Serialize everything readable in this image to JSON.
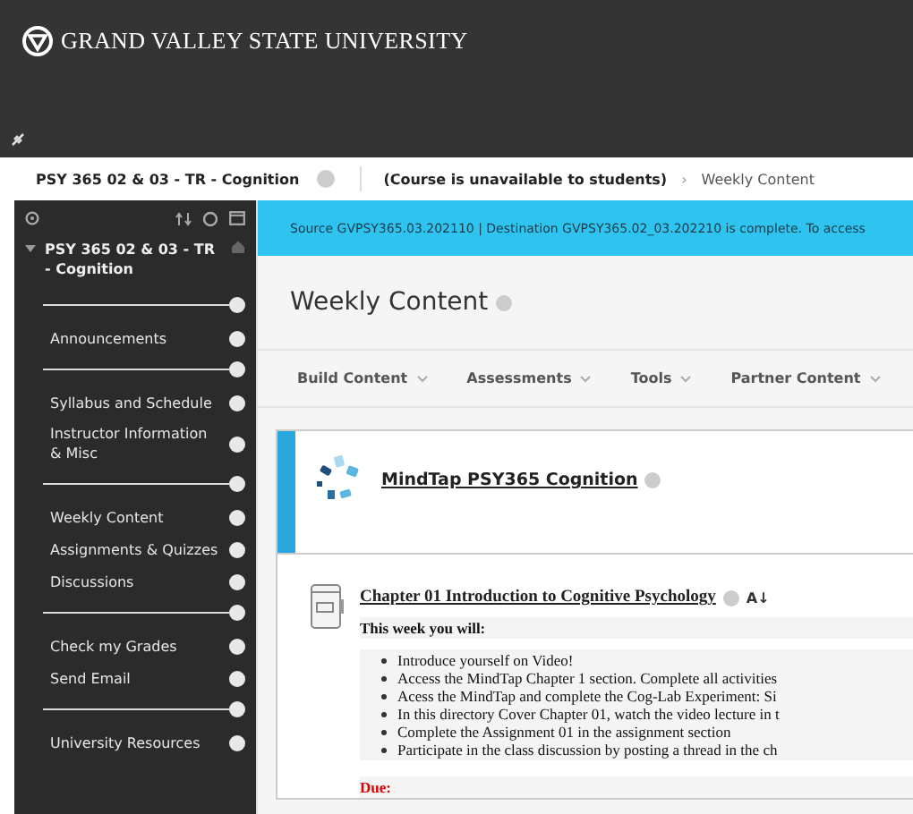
{
  "header": {
    "logo_text": "GRAND VALLEY STATE UNIVERSITY"
  },
  "breadcrumb": {
    "course": "PSY 365 02 & 03 - TR - Cognition",
    "status": "(Course is unavailable to students)",
    "separator": "›",
    "page": "Weekly Content"
  },
  "sidebar": {
    "course_title": "PSY 365 02 & 03 - TR - Cognition",
    "expanded": true,
    "items": [
      {
        "kind": "divider"
      },
      {
        "kind": "link",
        "label": "Announcements"
      },
      {
        "kind": "divider"
      },
      {
        "kind": "link",
        "label": "Syllabus and Schedule"
      },
      {
        "kind": "link",
        "label": "Instructor Information & Misc"
      },
      {
        "kind": "divider"
      },
      {
        "kind": "link",
        "label": "Weekly Content"
      },
      {
        "kind": "link",
        "label": "Assignments & Quizzes"
      },
      {
        "kind": "link",
        "label": "Discussions"
      },
      {
        "kind": "divider"
      },
      {
        "kind": "link",
        "label": "Check my Grades"
      },
      {
        "kind": "link",
        "label": "Send Email"
      },
      {
        "kind": "divider"
      },
      {
        "kind": "link",
        "label": "University Resources"
      }
    ]
  },
  "banner": {
    "text": "Source GVPSY365.03.202110 | Destination GVPSY365.02_03.202210 is complete. To access"
  },
  "page_title": "Weekly Content",
  "toolbar": [
    "Build Content",
    "Assessments",
    "Tools",
    "Partner Content"
  ],
  "content": [
    {
      "kind": "tool",
      "title": "MindTap PSY365 Cognition"
    },
    {
      "kind": "item",
      "title": "Chapter 01 Introduction to Cognitive Psychology",
      "release_mark": "A↓",
      "intro": "This week you will:",
      "bullets": [
        "Introduce yourself on Video!",
        "Access the MindTap Chapter 1 section. Complete all activities",
        "Acess the MindTap and complete the Cog-Lab Experiment: Si",
        "In this directory Cover Chapter 01, watch the video lecture in t",
        "Complete the Assignment 01 in the assignment section",
        "Participate in the class discussion by posting a thread in the ch"
      ],
      "due": "Due:"
    }
  ]
}
